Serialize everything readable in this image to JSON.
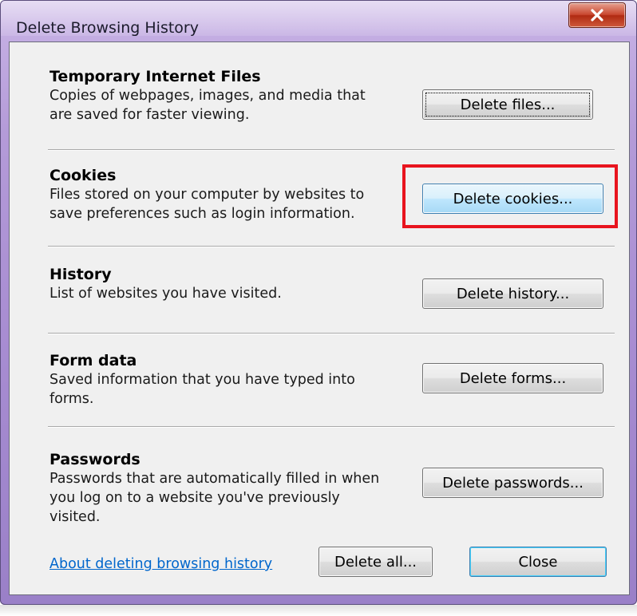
{
  "window": {
    "title": "Delete Browsing History",
    "close_icon": "close-icon",
    "accent_colors": {
      "frame": "#a88dd2",
      "close": "#c9472f",
      "highlight": "#e8141e",
      "link": "#0066cc"
    }
  },
  "sections": [
    {
      "heading": "Temporary Internet Files",
      "lines": [
        "Copies of webpages, images, and media that",
        "are saved for faster viewing."
      ],
      "button": "Delete files..."
    },
    {
      "heading": "Cookies",
      "lines": [
        "Files stored on your computer by websites to",
        "save preferences such as login information."
      ],
      "button": "Delete cookies..."
    },
    {
      "heading": "History",
      "lines": [
        "List of websites you have visited."
      ],
      "button": "Delete history..."
    },
    {
      "heading": "Form data",
      "lines": [
        "Saved information that you have typed into",
        "forms."
      ],
      "button": "Delete forms..."
    },
    {
      "heading": "Passwords",
      "lines": [
        "Passwords that are automatically filled in when",
        "you log on to a website you've previously",
        "visited."
      ],
      "button": "Delete passwords..."
    }
  ],
  "footer": {
    "link": "About deleting browsing history",
    "delete_all": "Delete all...",
    "close": "Close"
  }
}
